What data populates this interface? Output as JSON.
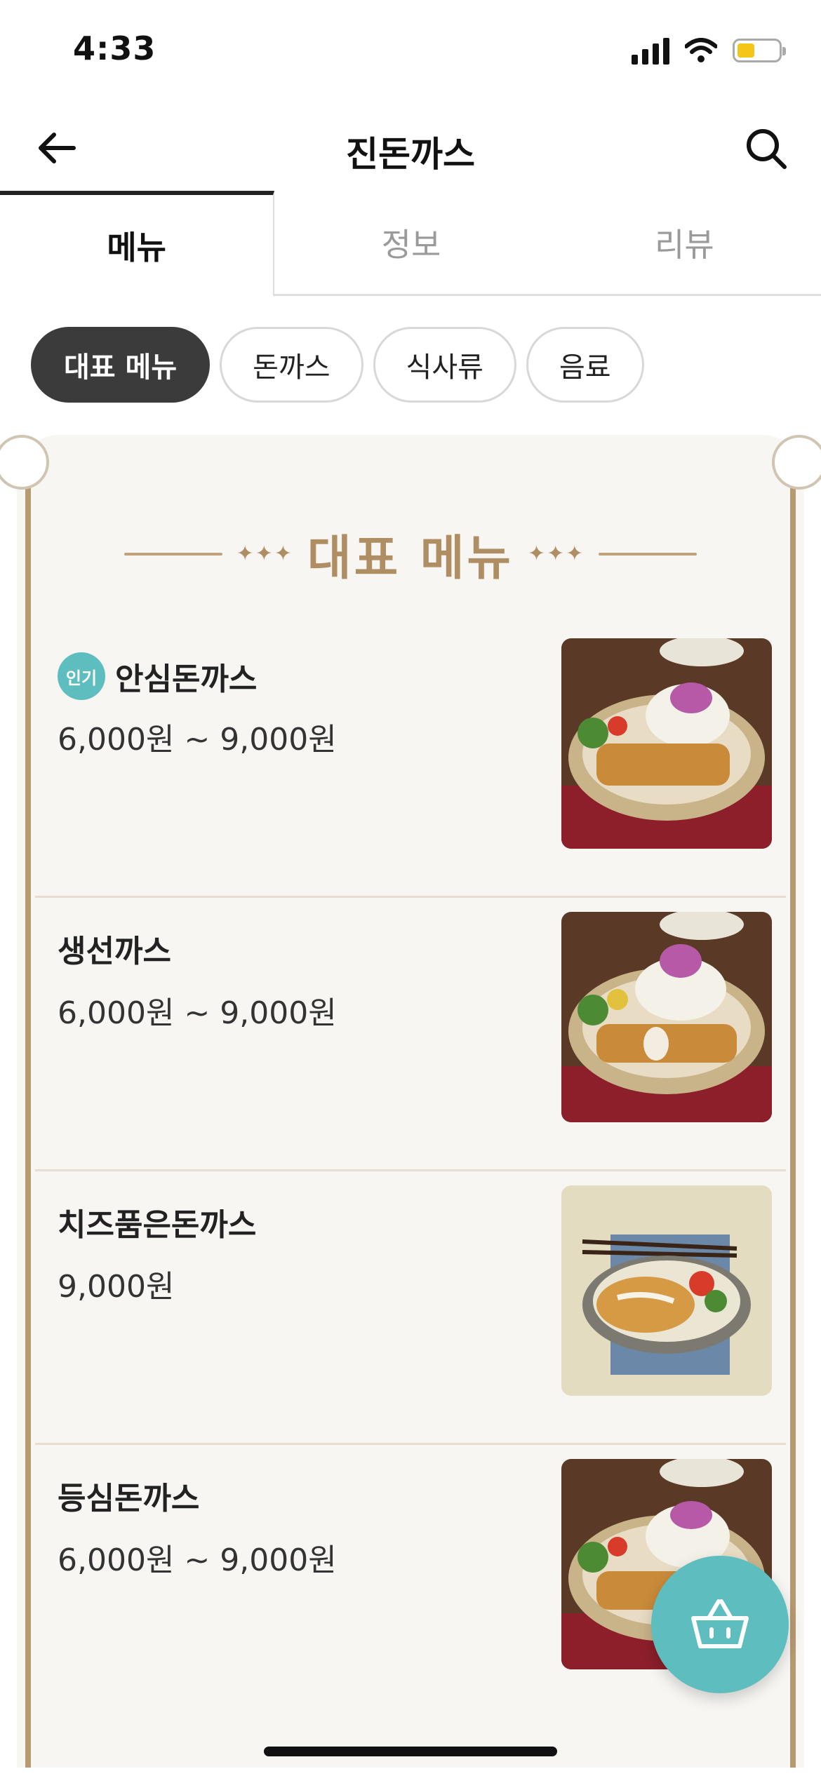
{
  "status_bar": {
    "time": "4:33"
  },
  "header": {
    "title": "진돈까스"
  },
  "tabs": [
    {
      "label": "메뉴",
      "active": true
    },
    {
      "label": "정보",
      "active": false
    },
    {
      "label": "리뷰",
      "active": false
    }
  ],
  "chips": [
    {
      "label": "대표 메뉴",
      "active": true
    },
    {
      "label": "돈까스",
      "active": false
    },
    {
      "label": "식사류",
      "active": false
    },
    {
      "label": "음료",
      "active": false
    }
  ],
  "section": {
    "title": "대표 메뉴"
  },
  "menu_items": [
    {
      "badge": "인기",
      "name": "안심돈까스",
      "price": "6,000원 ~ 9,000원"
    },
    {
      "name": "생선까스",
      "price": "6,000원 ~ 9,000원"
    },
    {
      "name": "치즈품은돈까스",
      "price": "9,000원"
    },
    {
      "name": "등심돈까스",
      "price": "6,000원 ~ 9,000원"
    }
  ],
  "colors": {
    "accent": "#5ebebf",
    "gold": "#b08e64",
    "chip_active": "#3b3b3b"
  }
}
